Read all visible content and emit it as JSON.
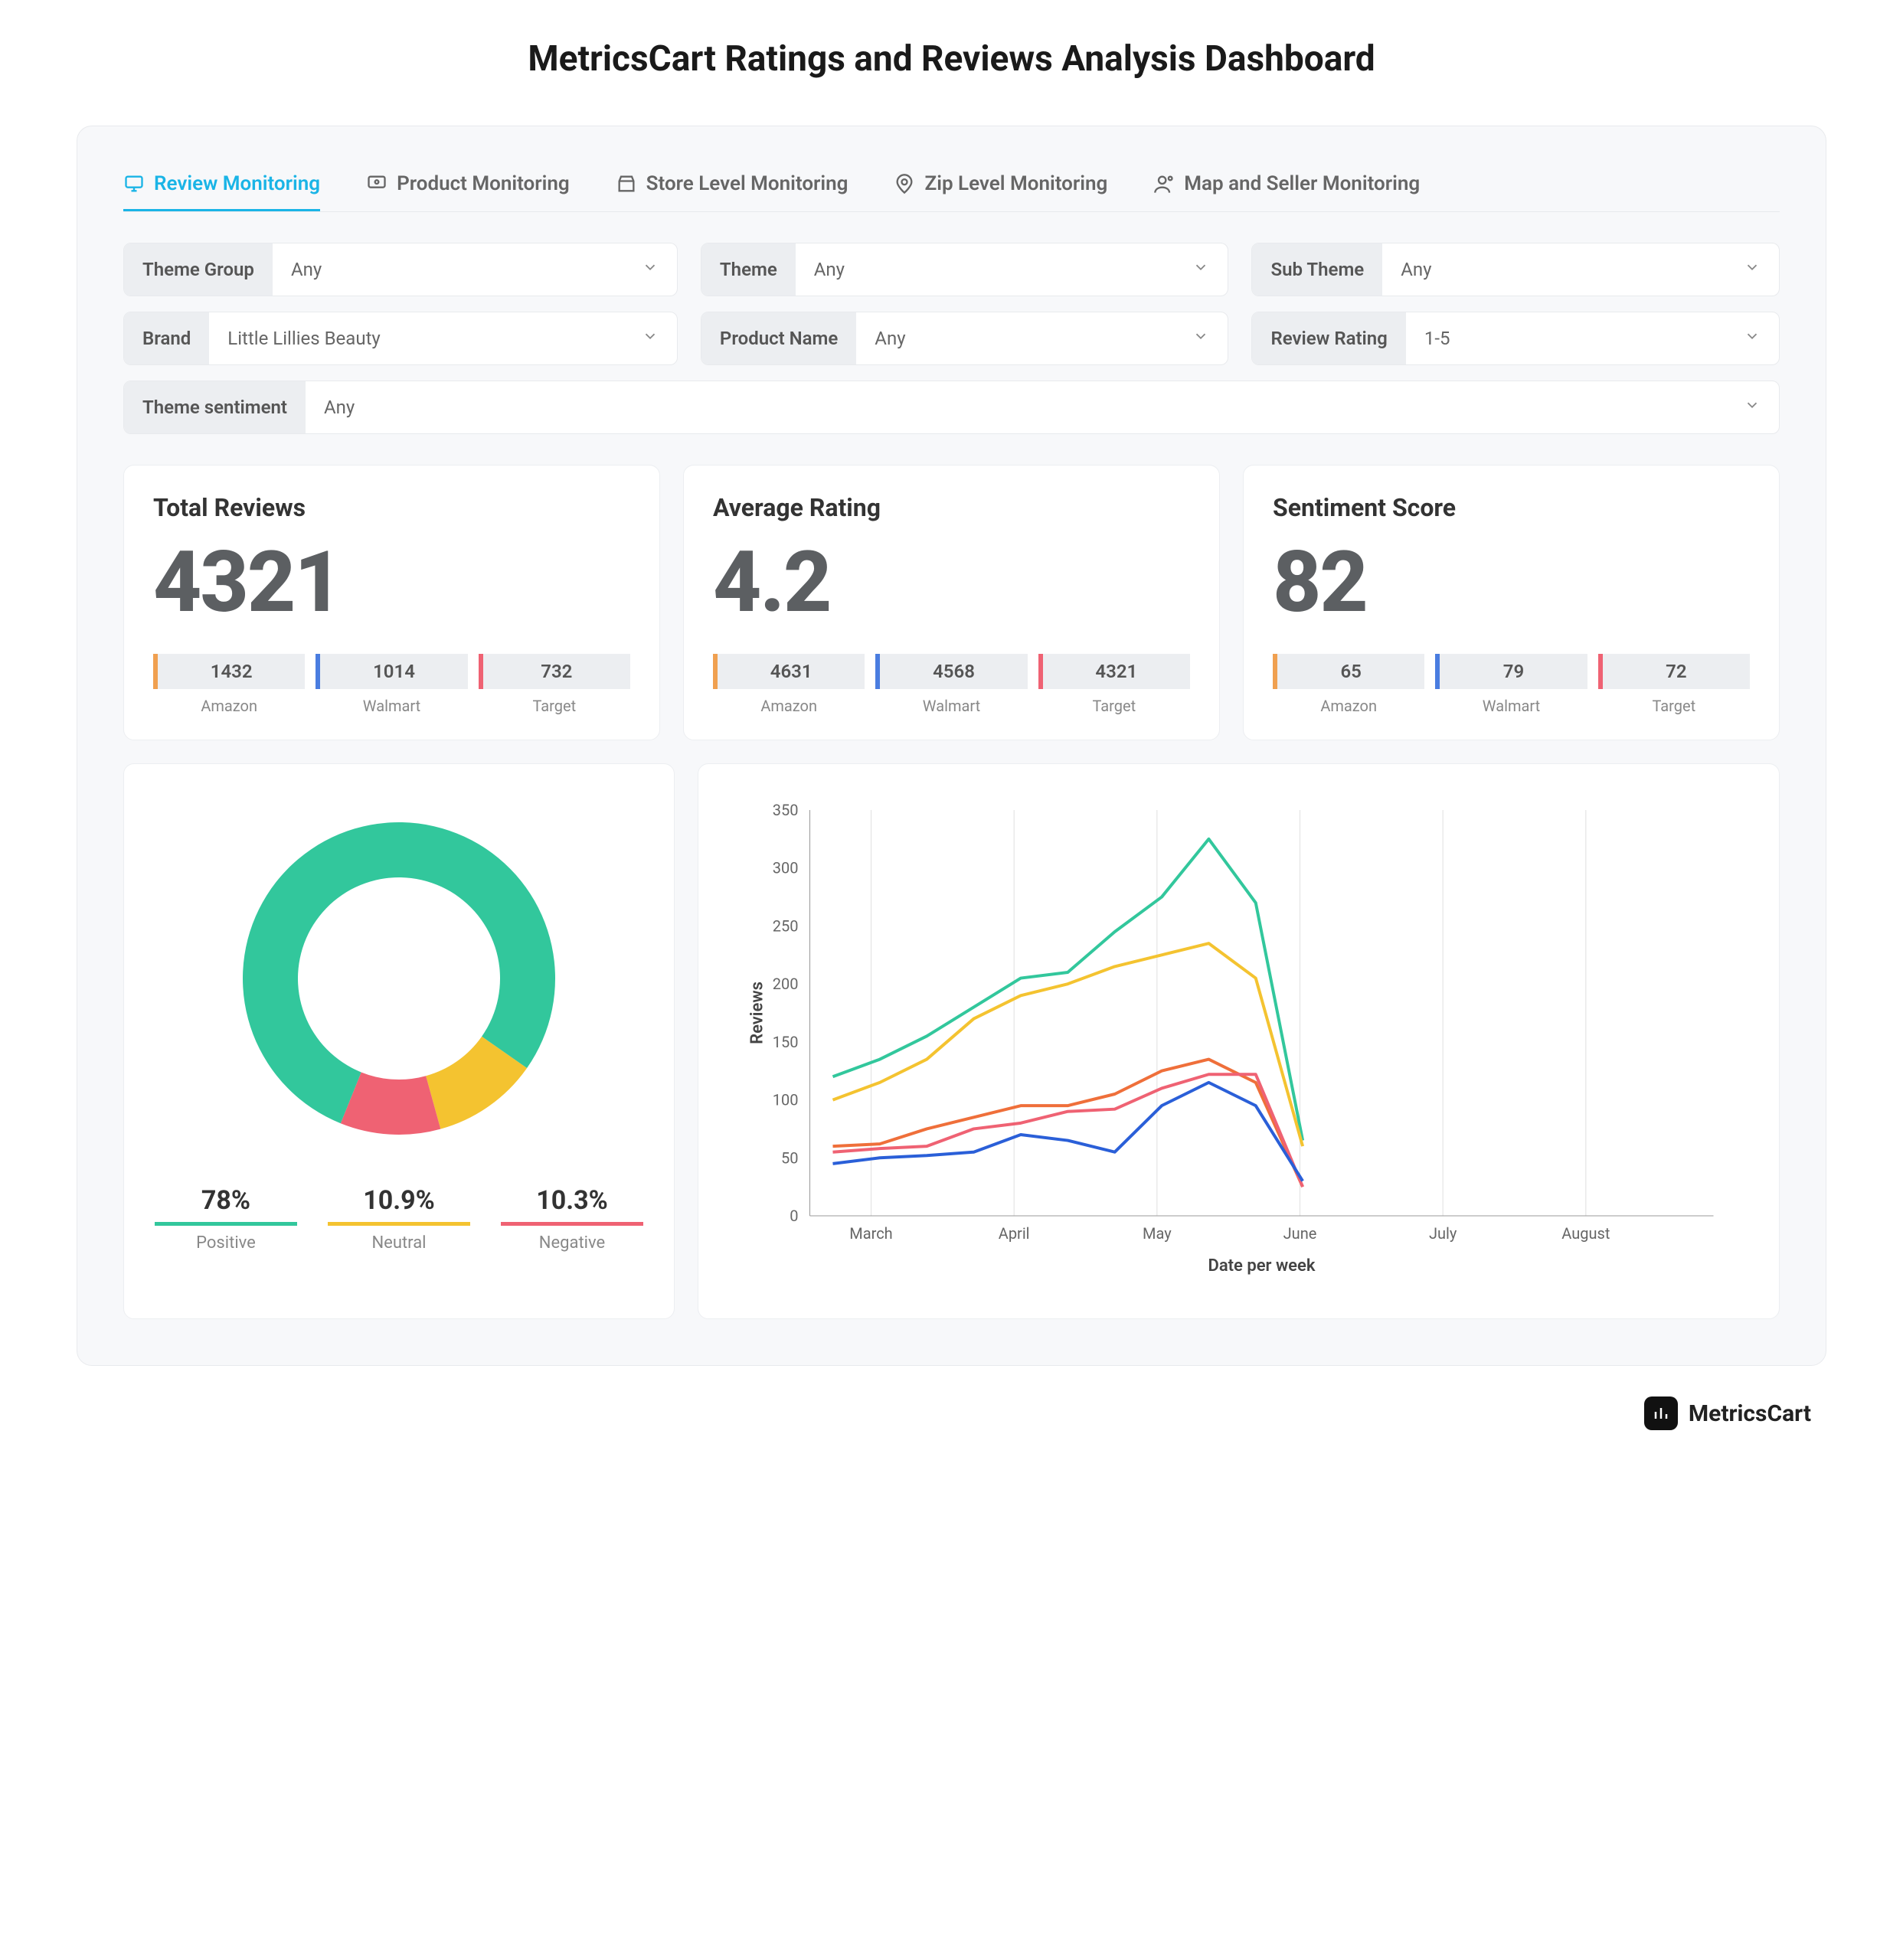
{
  "page_title": "MetricsCart Ratings and Reviews Analysis Dashboard",
  "tabs": [
    {
      "label": "Review Monitoring",
      "active": true
    },
    {
      "label": "Product Monitoring",
      "active": false
    },
    {
      "label": "Store Level Monitoring",
      "active": false
    },
    {
      "label": "Zip Level  Monitoring",
      "active": false
    },
    {
      "label": "Map and Seller Monitoring",
      "active": false
    }
  ],
  "filters": {
    "theme_group": {
      "label": "Theme Group",
      "value": "Any"
    },
    "theme": {
      "label": "Theme",
      "value": "Any"
    },
    "sub_theme": {
      "label": "Sub Theme",
      "value": "Any"
    },
    "brand": {
      "label": "Brand",
      "value": "Little Lillies Beauty"
    },
    "product_name": {
      "label": "Product Name",
      "value": "Any"
    },
    "review_rating": {
      "label": "Review Rating",
      "value": "1-5"
    },
    "theme_sentiment": {
      "label": "Theme sentiment",
      "value": "Any"
    }
  },
  "kpis": {
    "total_reviews": {
      "title": "Total Reviews",
      "value": "4321",
      "breakdown": [
        {
          "label": "Amazon",
          "value": "1432",
          "accent": "amazon"
        },
        {
          "label": "Walmart",
          "value": "1014",
          "accent": "walmart"
        },
        {
          "label": "Target",
          "value": "732",
          "accent": "target"
        }
      ]
    },
    "average_rating": {
      "title": "Average Rating",
      "value": "4.2",
      "breakdown": [
        {
          "label": "Amazon",
          "value": "4631",
          "accent": "amazon"
        },
        {
          "label": "Walmart",
          "value": "4568",
          "accent": "walmart"
        },
        {
          "label": "Target",
          "value": "4321",
          "accent": "target"
        }
      ]
    },
    "sentiment_score": {
      "title": "Sentiment Score",
      "value": "82",
      "breakdown": [
        {
          "label": "Amazon",
          "value": "65",
          "accent": "amazon"
        },
        {
          "label": "Walmart",
          "value": "79",
          "accent": "walmart"
        },
        {
          "label": "Target",
          "value": "72",
          "accent": "target"
        }
      ]
    }
  },
  "chart_data": [
    {
      "type": "pie",
      "title": "Sentiment distribution",
      "series": [
        {
          "name": "Positive",
          "value": 78.0,
          "pct_label": "78%",
          "color": "#32c79c"
        },
        {
          "name": "Neutral",
          "value": 10.9,
          "pct_label": "10.9%",
          "color": "#f4c330"
        },
        {
          "name": "Negative",
          "value": 10.3,
          "pct_label": "10.3%",
          "color": "#ef6273"
        }
      ]
    },
    {
      "type": "line",
      "title": "Reviews over time",
      "xlabel": "Date per week",
      "ylabel": "Reviews",
      "ylim": [
        0,
        350
      ],
      "x_ticks": [
        "March",
        "April",
        "May",
        "June",
        "July",
        "August"
      ],
      "series_colors": {
        "s1": "#32c79c",
        "s2": "#f4c330",
        "s3": "#ef6f3a",
        "s4": "#ef6273",
        "s5": "#2a5fd8"
      },
      "series": [
        {
          "name": "s1",
          "color": "#32c79c",
          "values": [
            120,
            135,
            155,
            180,
            205,
            210,
            245,
            275,
            325,
            270,
            65
          ]
        },
        {
          "name": "s2",
          "color": "#f4c330",
          "values": [
            100,
            115,
            135,
            170,
            190,
            200,
            215,
            225,
            235,
            205,
            60
          ]
        },
        {
          "name": "s3",
          "color": "#ef6f3a",
          "values": [
            60,
            62,
            75,
            85,
            95,
            95,
            105,
            125,
            135,
            115,
            25
          ]
        },
        {
          "name": "s4",
          "color": "#ef6273",
          "values": [
            55,
            58,
            60,
            75,
            80,
            90,
            92,
            110,
            122,
            122,
            25
          ]
        },
        {
          "name": "s5",
          "color": "#2a5fd8",
          "values": [
            45,
            50,
            52,
            55,
            70,
            65,
            55,
            95,
            115,
            95,
            30
          ]
        }
      ]
    }
  ],
  "footer": {
    "brand": "MetricsCart"
  }
}
